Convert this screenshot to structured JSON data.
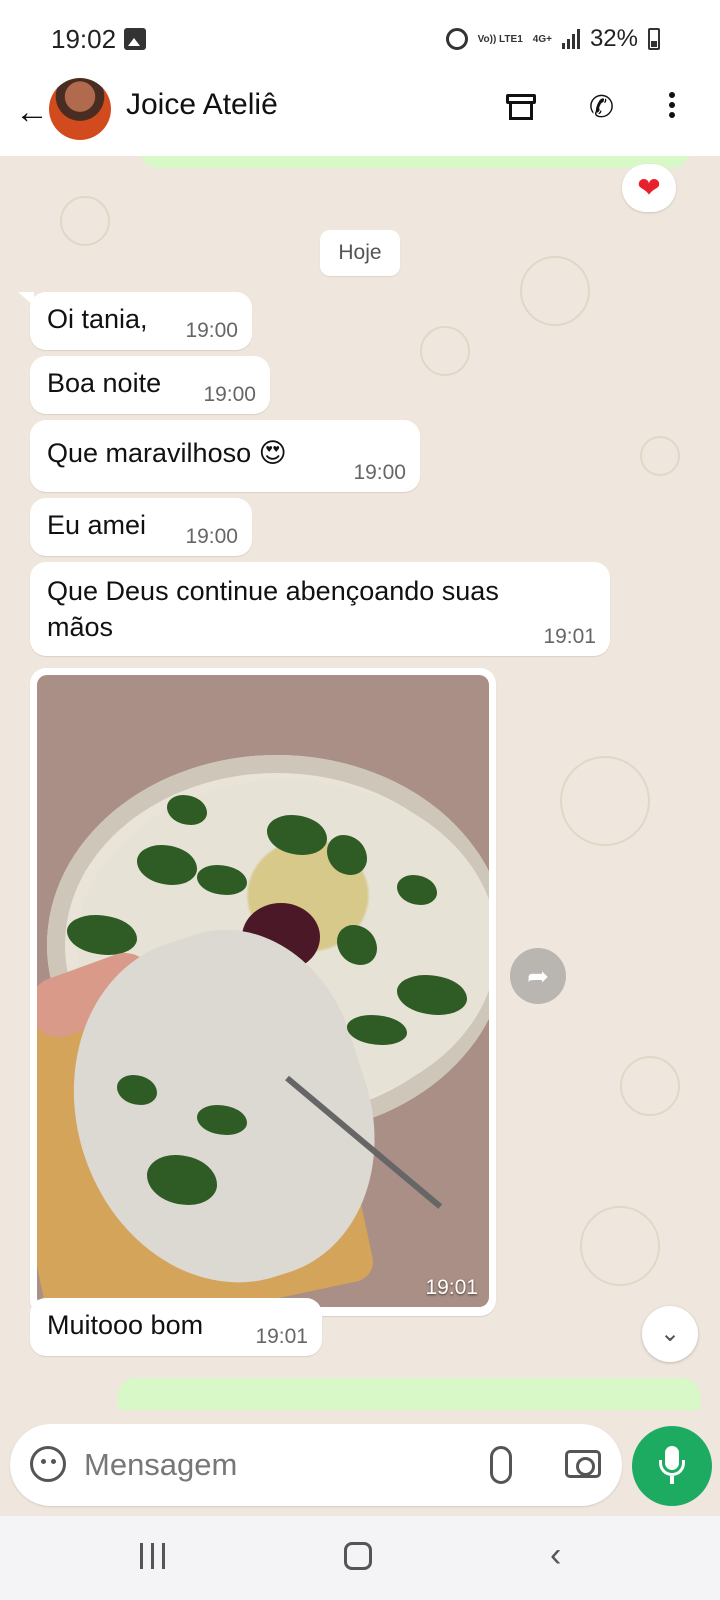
{
  "status_bar": {
    "time": "19:02",
    "network_volte": "Vo)) LTE1",
    "network_4g": "4G+",
    "battery": "32%"
  },
  "header": {
    "contact_name": "Joice Ateliê"
  },
  "chat": {
    "reaction": "❤",
    "date_chip": "Hoje",
    "messages": [
      {
        "text": "Oi tania,",
        "time": "19:00"
      },
      {
        "text": "Boa noite",
        "time": "19:00"
      },
      {
        "text": "Que maravilhoso 😍",
        "time": "19:00"
      },
      {
        "text": "Eu amei",
        "time": "19:00"
      },
      {
        "text_line1": "Que Deus continue abençoando suas",
        "text_line2": "mãos",
        "time": "19:01"
      },
      {
        "type": "image",
        "time": "19:01"
      },
      {
        "text": "Muitooo bom",
        "time": "19:01"
      }
    ]
  },
  "input": {
    "placeholder": "Mensagem"
  },
  "colors": {
    "accent": "#1daa61",
    "sent_bubble": "#d8f8c7",
    "wallpaper": "#efe7dd"
  }
}
